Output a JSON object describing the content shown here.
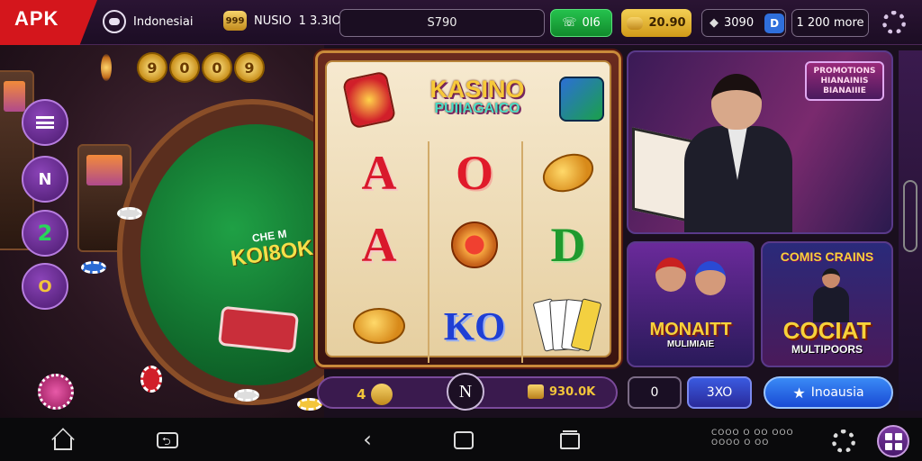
{
  "topbar": {
    "apk_label": "APK",
    "region_label": "Indonesiai",
    "coin_badge": "999",
    "coin_value": "NUSIO",
    "stat_value": "1 3.3IO",
    "search_value": "S790",
    "green_value": "0I6",
    "gold_value": "20.90",
    "dark_value": "3090",
    "blue_badge": "D",
    "more_label": "1 200 more"
  },
  "left": {
    "felt_small_text": "CHE M",
    "felt_text": "KOI8OK",
    "coins": [
      "9",
      "0",
      "0",
      "9"
    ],
    "side_buttons": [
      "",
      "N",
      "2",
      "O"
    ]
  },
  "slot": {
    "title_line1": "KASINO",
    "title_line2": "PUIIAGAICO",
    "reel1": [
      "A",
      "A",
      ""
    ],
    "reel2": [
      "O",
      "",
      "KO"
    ],
    "reel3": [
      "",
      "D",
      ""
    ]
  },
  "center_bar": {
    "left_value": "4",
    "n_label": "N",
    "right_value": "930.0K"
  },
  "panels": {
    "top_badge": "PROMOTIONS HIANAINIS BIANAIIIE",
    "sm1_title": "MONAITT",
    "sm1_sub": "MULIMIAIE",
    "sm2_top": "COMIS CRAINS",
    "sm2_title": "COCIAT",
    "sm2_sub": "MULTIPOORS"
  },
  "bottom_right": {
    "zero_value": "0",
    "value_btn": "3XO",
    "region_btn": "Inoausia"
  },
  "navbar": {
    "nav_text_line1": "COOO O OO OOO",
    "nav_text_line2": "OOOO O OO"
  },
  "colors": {
    "apk_red": "#d4161c",
    "accent_purple": "#7a3aa0",
    "gold": "#f3c53a",
    "green": "#25c24d",
    "blue": "#3a8af6"
  }
}
